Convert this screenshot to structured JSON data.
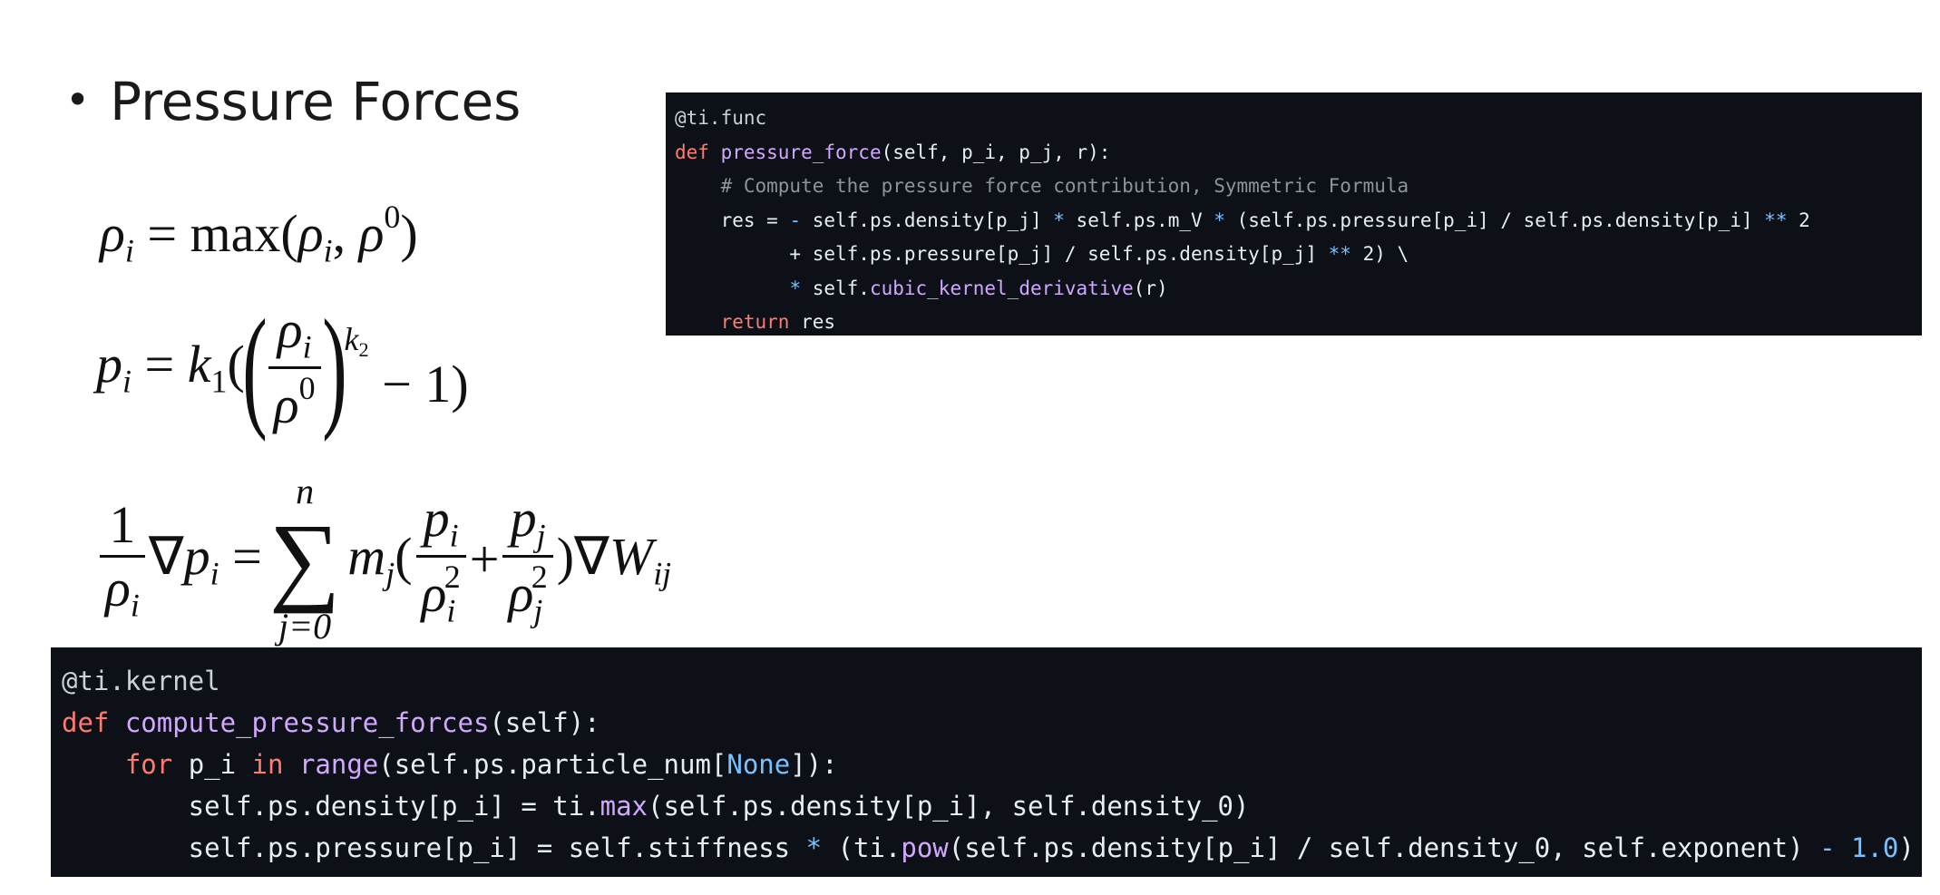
{
  "slide": {
    "bullet_text": "Pressure Forces"
  },
  "code_pressure_force": [
    [
      [
        "dec",
        "@ti.func"
      ]
    ],
    [
      [
        "kw",
        "def "
      ],
      [
        "fn",
        "pressure_force"
      ],
      [
        "tx",
        "(self, p_i, p_j, r):"
      ]
    ],
    [
      [
        "tx",
        "    "
      ],
      [
        "cm",
        "# Compute the pressure force contribution, Symmetric Formula"
      ]
    ],
    [
      [
        "tx",
        "    res = "
      ],
      [
        "op",
        "-"
      ],
      [
        "tx",
        " self.ps.density[p_j] "
      ],
      [
        "op",
        "*"
      ],
      [
        "tx",
        " self.ps.m_V "
      ],
      [
        "op",
        "*"
      ],
      [
        "tx",
        " (self.ps.pressure[p_i] / self.ps.density[p_i] "
      ],
      [
        "op",
        "**"
      ],
      [
        "tx",
        " 2"
      ]
    ],
    [
      [
        "tx",
        "          + self.ps.pressure[p_j] / self.ps.density[p_j] "
      ],
      [
        "op",
        "**"
      ],
      [
        "tx",
        " 2) \\"
      ]
    ],
    [
      [
        "tx",
        "          "
      ],
      [
        "op",
        "*"
      ],
      [
        "tx",
        " self."
      ],
      [
        "fn",
        "cubic_kernel_derivative"
      ],
      [
        "tx",
        "(r)"
      ]
    ],
    [
      [
        "tx",
        "    "
      ],
      [
        "kw",
        "return"
      ],
      [
        "tx",
        " res"
      ]
    ]
  ],
  "code_compute_pressure_forces": [
    [
      [
        "dec",
        "@ti.kernel"
      ]
    ],
    [
      [
        "kw",
        "def "
      ],
      [
        "fn",
        "compute_pressure_forces"
      ],
      [
        "tx",
        "(self):"
      ]
    ],
    [
      [
        "tx",
        "    "
      ],
      [
        "kw",
        "for"
      ],
      [
        "tx",
        " p_i "
      ],
      [
        "kw",
        "in"
      ],
      [
        "tx",
        " "
      ],
      [
        "fn",
        "range"
      ],
      [
        "tx",
        "(self.ps.particle_num["
      ],
      [
        "bi",
        "None"
      ],
      [
        "tx",
        "]):"
      ]
    ],
    [
      [
        "tx",
        "        self.ps.density[p_i] = ti."
      ],
      [
        "fn",
        "max"
      ],
      [
        "tx",
        "(self.ps.density[p_i], self.density_0)"
      ]
    ],
    [
      [
        "tx",
        "        self.ps.pressure[p_i] = self.stiffness "
      ],
      [
        "op",
        "*"
      ],
      [
        "tx",
        " (ti."
      ],
      [
        "fn",
        "pow"
      ],
      [
        "tx",
        "(self.ps.density[p_i] / self.density_0, self.exponent) "
      ],
      [
        "op",
        "-"
      ],
      [
        "tx",
        " "
      ],
      [
        "op",
        "1.0"
      ],
      [
        "tx",
        ")"
      ]
    ]
  ]
}
